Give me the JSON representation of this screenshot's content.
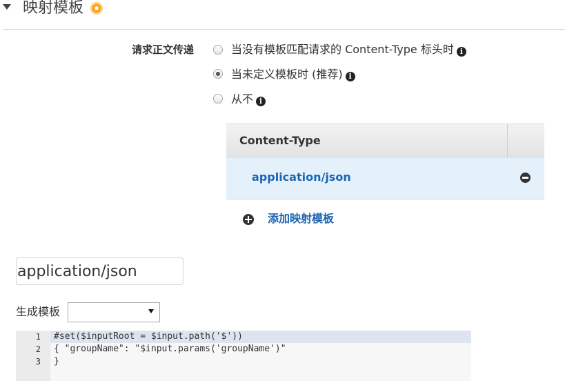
{
  "section": {
    "title": "映射模板"
  },
  "passthrough": {
    "label": "请求正文传递",
    "options": [
      {
        "label": "当没有模板匹配请求的 Content-Type 标头时",
        "selected": false
      },
      {
        "label": "当未定义模板时 (推荐)",
        "selected": true
      },
      {
        "label": "从不",
        "selected": false
      }
    ]
  },
  "content_type_table": {
    "header": "Content-Type",
    "rows": [
      {
        "value": "application/json"
      }
    ],
    "add_label": "添加映射模板"
  },
  "content_type_input": {
    "value": "application/json"
  },
  "generate_template": {
    "label": "生成模板",
    "selected": ""
  },
  "editor": {
    "line_numbers": [
      "1",
      "2",
      "3"
    ],
    "lines": [
      "#set($inputRoot = $input.path('$'))",
      "{ \"groupName\": \"$input.params('groupName')\"",
      "}"
    ]
  },
  "colors": {
    "accent_orange": "#ff9900",
    "link_blue": "#1a66b3",
    "selected_row": "#e4f1fb"
  }
}
